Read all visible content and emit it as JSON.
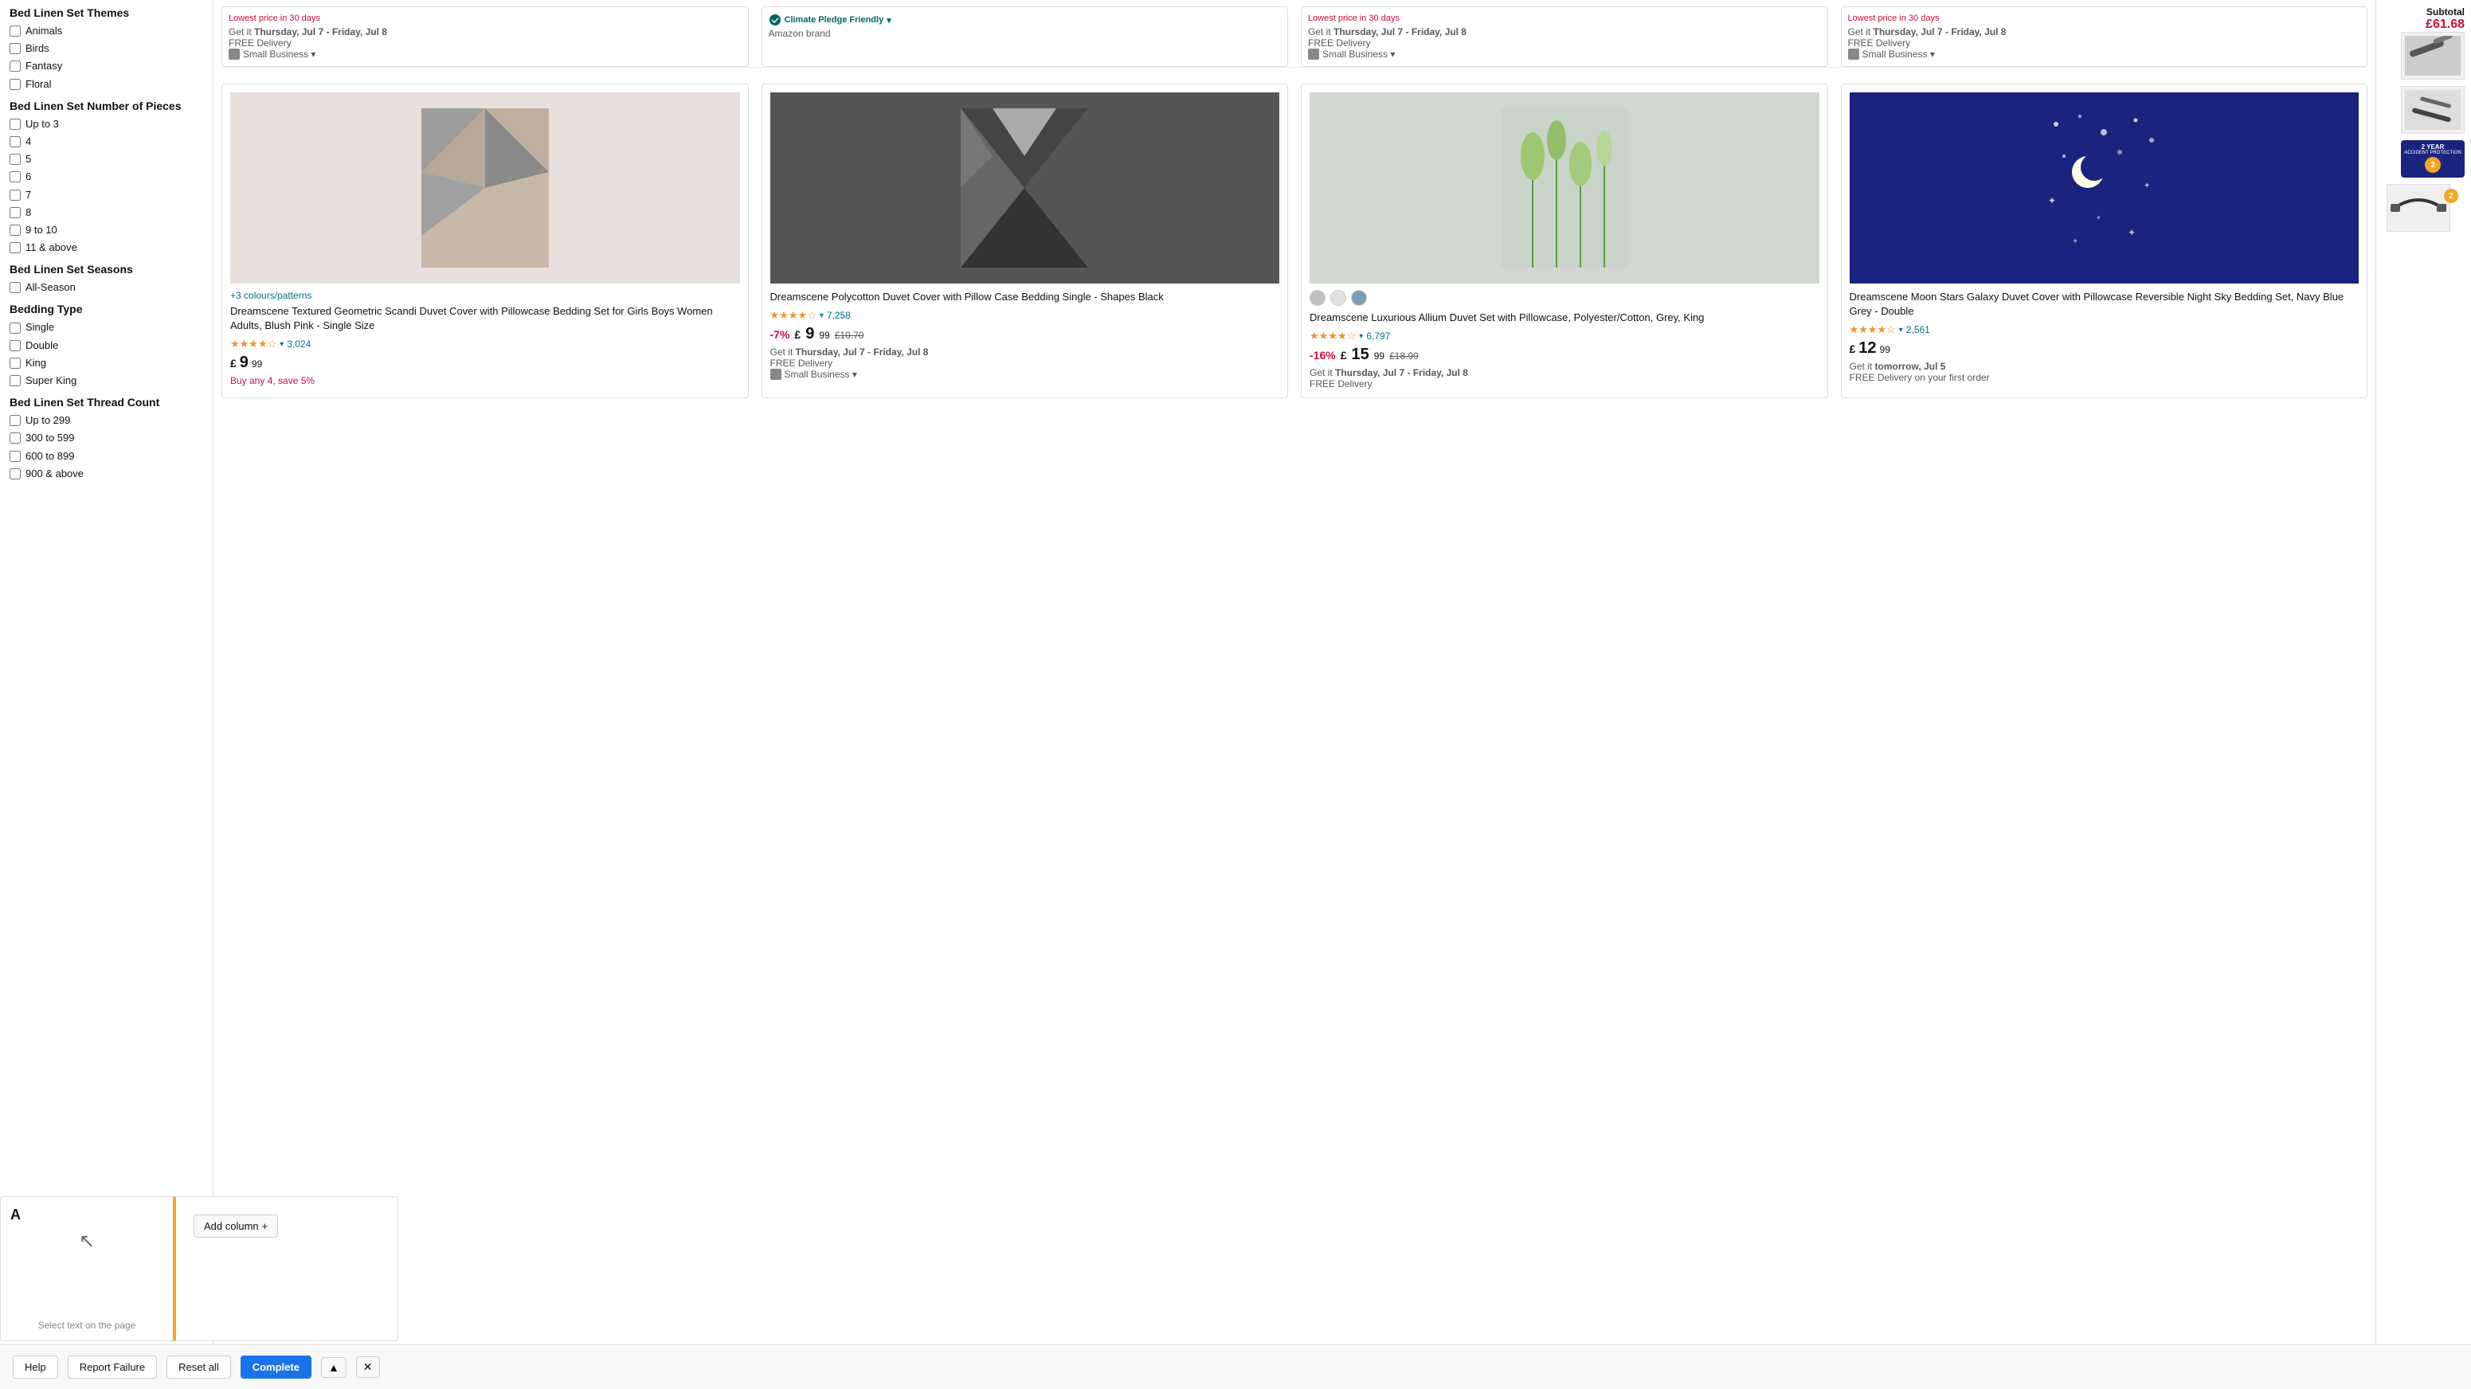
{
  "sidebar": {
    "sections": [
      {
        "title": "Bed Linen Set Number of Pieces",
        "items": [
          {
            "label": "Up to 3",
            "checked": false
          },
          {
            "label": "4",
            "checked": false
          },
          {
            "label": "5",
            "checked": false
          },
          {
            "label": "6",
            "checked": false
          },
          {
            "label": "7",
            "checked": false
          },
          {
            "label": "8",
            "checked": false
          },
          {
            "label": "9 to 10",
            "checked": false
          },
          {
            "label": "11 & above",
            "checked": false
          }
        ]
      },
      {
        "title": "Bed Linen Set Seasons",
        "items": [
          {
            "label": "All-Season",
            "checked": false
          }
        ]
      },
      {
        "title": "Bedding Type",
        "items": [
          {
            "label": "Single",
            "checked": false
          },
          {
            "label": "Double",
            "checked": false
          },
          {
            "label": "King",
            "checked": false
          },
          {
            "label": "Super King",
            "checked": false
          }
        ]
      },
      {
        "title": "Bed Linen Set Thread Count",
        "items": [
          {
            "label": "Up to 299",
            "checked": false
          },
          {
            "label": "300 to 599",
            "checked": false
          },
          {
            "label": "600 to 899",
            "checked": false
          },
          {
            "label": "900 & above",
            "checked": false
          }
        ]
      }
    ],
    "theme_section": {
      "title": "Bed Linen Set Themes",
      "items": [
        {
          "label": "Animals",
          "checked": false
        },
        {
          "label": "Birds",
          "checked": false
        },
        {
          "label": "Fantasy",
          "checked": false
        },
        {
          "label": "Floral",
          "checked": false
        }
      ]
    }
  },
  "products": [
    {
      "id": 1,
      "color_link": "+3 colours/patterns",
      "title": "Dreamscene Textured Geometric Scandi Duvet Cover with Pillowcase Bedding Set for Girls Boys Women Adults, Blush Pink - Single Size",
      "stars": 3.5,
      "review_count": "3,024",
      "price_currency": "£",
      "price_whole": "9",
      "price_decimal": "99",
      "price_original": null,
      "discount": null,
      "delivery_date": null,
      "delivery_line": null,
      "free_delivery": null,
      "extra": "Buy any 4, save 5%",
      "has_climate": false,
      "swatches": []
    },
    {
      "id": 2,
      "color_link": null,
      "title": "Dreamscene Polycotton Duvet Cover with Pillow Case Bedding Single - Shapes Black",
      "stars": 4,
      "review_count": "7,258",
      "price_currency": "£",
      "price_whole": "9",
      "price_decimal": "99",
      "price_original": "£10.70",
      "discount": "-7%",
      "delivery_day": "Thursday, Jul 7 - Friday, Jul 8",
      "free_delivery": "FREE Delivery",
      "extra": null,
      "has_climate": false,
      "swatches": [],
      "small_business": true
    },
    {
      "id": 3,
      "color_link": null,
      "title": "Dreamscene Luxurious Allium Duvet Set with Pillowcase, Polyester/Cotton, Grey, King",
      "stars": 4,
      "review_count": "6,797",
      "price_currency": "£",
      "price_whole": "15",
      "price_decimal": "99",
      "price_original": "£18.99",
      "discount": "-16%",
      "delivery_day": "Thursday, Jul 7 - Friday, Jul 8",
      "free_delivery": "FREE Delivery",
      "extra": null,
      "has_climate": false,
      "swatches": [
        "#c0c0c0",
        "#e0e0e0",
        "#7a9eb5"
      ]
    },
    {
      "id": 4,
      "color_link": null,
      "title": "Dreamscene Moon Stars Galaxy Duvet Cover with Pillowcase Reversible Night Sky Bedding Set, Navy Blue Grey - Double",
      "stars": 4,
      "review_count": "2,561",
      "price_currency": "£",
      "price_whole": "12",
      "price_decimal": "99",
      "price_original": null,
      "discount": null,
      "delivery_day": "tomorrow, Jul 5",
      "free_delivery": "FREE Delivery on your first order",
      "extra": null,
      "has_climate": false,
      "swatches": []
    }
  ],
  "top_products": [
    {
      "delivery_prefix": "Lowest price in 30 days",
      "delivery_day": "Thursday, Jul 7 - Friday, Jul 8",
      "free_delivery": "FREE Delivery",
      "small_business": true
    },
    {
      "delivery_prefix": "Lowest price in 30 days",
      "delivery_day": "Thursday, Jul 7 - Friday, Jul 8",
      "free_delivery": "FREE Delivery",
      "small_business": true
    }
  ],
  "climate_badge": {
    "label": "Climate Pledge Friendly",
    "sublabel": "Amazon brand"
  },
  "right_sidebar": {
    "subtotal_label": "Subtotal",
    "subtotal_price": "£61.68",
    "badge_2yr": "2 YEAR",
    "badge_text": "ACCIDENT PROTECTION",
    "badge_num": "2"
  },
  "toolbar": {
    "help_label": "Help",
    "report_label": "Report Failure",
    "reset_label": "Reset all",
    "complete_label": "Complete"
  },
  "bottom_panel": {
    "column_label": "A",
    "hint_label": "Select text on the page",
    "add_column_label": "Add column"
  }
}
